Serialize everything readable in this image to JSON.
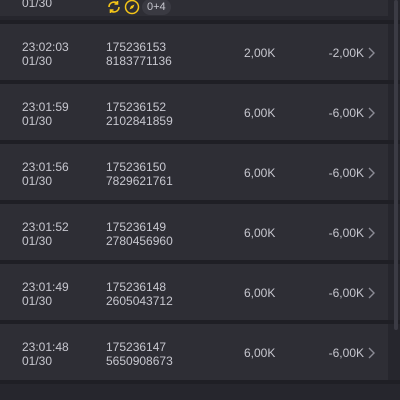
{
  "top_row": {
    "date": "01/30",
    "badge_extra": "0+4",
    "badge_icons": [
      "refresh-icon",
      "compass-icon"
    ],
    "badge_color": "#f5c518"
  },
  "rows": [
    {
      "time": "23:02:03",
      "date": "01/30",
      "id_line1": "175236153",
      "id_line2": "8183771136",
      "amount": "2,00K",
      "pnl": "-2,00K"
    },
    {
      "time": "23:01:59",
      "date": "01/30",
      "id_line1": "175236152",
      "id_line2": "2102841859",
      "amount": "6,00K",
      "pnl": "-6,00K"
    },
    {
      "time": "23:01:56",
      "date": "01/30",
      "id_line1": "175236150",
      "id_line2": "7829621761",
      "amount": "6,00K",
      "pnl": "-6,00K"
    },
    {
      "time": "23:01:52",
      "date": "01/30",
      "id_line1": "175236149",
      "id_line2": "2780456960",
      "amount": "6,00K",
      "pnl": "-6,00K"
    },
    {
      "time": "23:01:49",
      "date": "01/30",
      "id_line1": "175236148",
      "id_line2": "2605043712",
      "amount": "6,00K",
      "pnl": "-6,00K"
    },
    {
      "time": "23:01:48",
      "date": "01/30",
      "id_line1": "175236147",
      "id_line2": "5650908673",
      "amount": "6,00K",
      "pnl": "-6,00K"
    }
  ],
  "colors": {
    "background": "#26262d",
    "row_background": "#2e2e35",
    "text": "#c7c7cf",
    "chevron": "#8a8a94"
  },
  "icons": {
    "row_action": "chevron-right-icon"
  }
}
